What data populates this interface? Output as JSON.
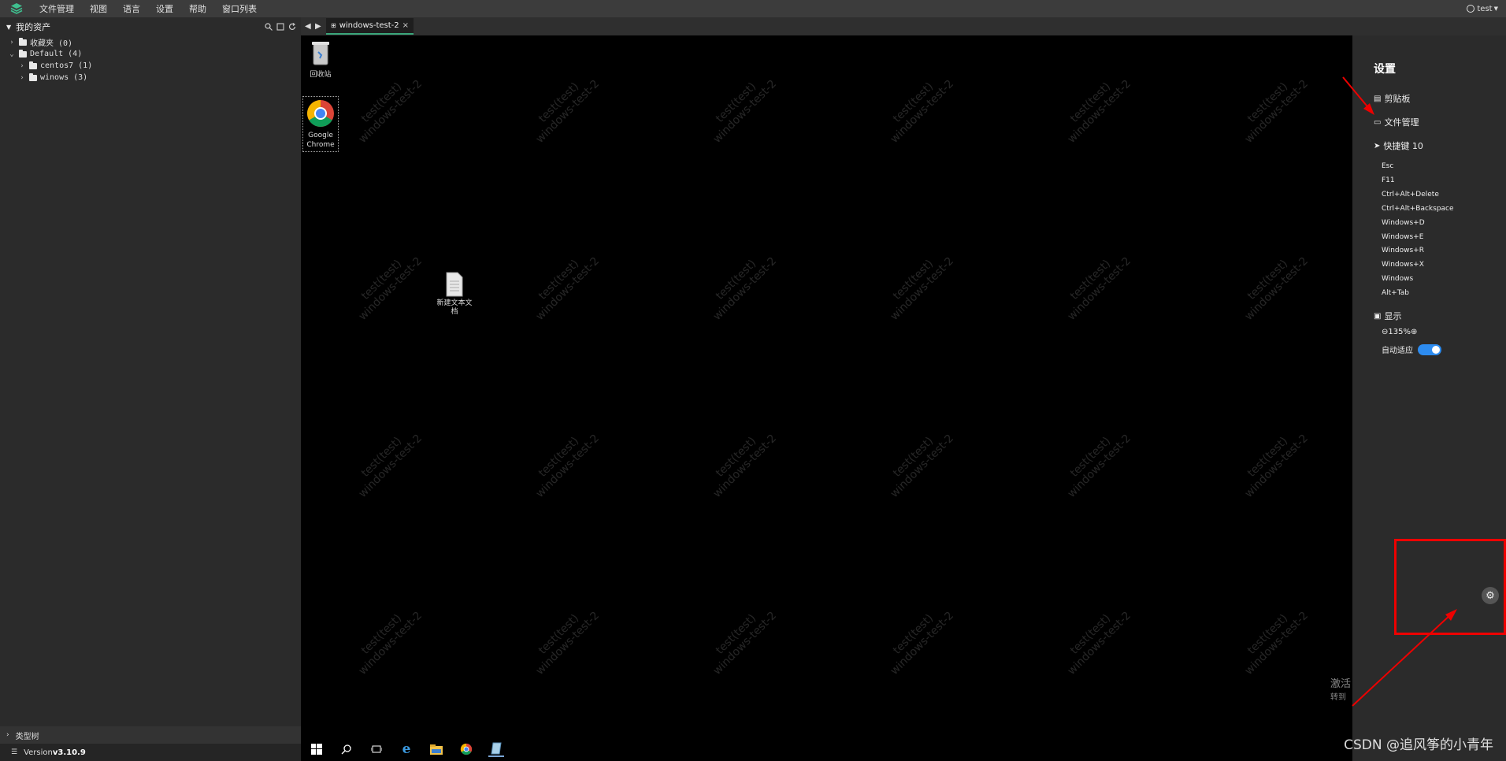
{
  "menubar": {
    "items": [
      "文件管理",
      "视图",
      "语言",
      "设置",
      "帮助",
      "窗口列表"
    ],
    "user": "test"
  },
  "left_panel": {
    "title": "我的资产",
    "tree": [
      {
        "label": "收藏夹 (0)",
        "level": 0,
        "expanded": false
      },
      {
        "label": "Default (4)",
        "level": 0,
        "expanded": true
      },
      {
        "label": "centos7 (1)",
        "level": 1,
        "expanded": false
      },
      {
        "label": "winows (3)",
        "level": 1,
        "expanded": false
      }
    ],
    "type_tree": "类型树",
    "version_label": "Version ",
    "version_value": "v3.10.9"
  },
  "tabbar": {
    "tab_label": "windows-test-2"
  },
  "desktop": {
    "watermark_line1": "test(test)",
    "watermark_line2": "windows-test-2",
    "icons": {
      "recycle_bin": "回收站",
      "chrome": "Google Chrome",
      "text_doc": "新建文本文档"
    },
    "activate_line1": "激活",
    "activate_line2": "转到"
  },
  "settings": {
    "title": "设置",
    "clipboard": "剪贴板",
    "file_manager": "文件管理",
    "shortcuts": "快捷键 10",
    "keys": [
      "Esc",
      "F11",
      "Ctrl+Alt+Delete",
      "Ctrl+Alt+Backspace",
      "Windows+D",
      "Windows+E",
      "Windows+R",
      "Windows+X",
      "Windows",
      "Alt+Tab"
    ],
    "display": "显示",
    "zoom": "135%",
    "auto_fit": "自动适应",
    "auto_fit_on": true
  },
  "overlay": {
    "csdn": "CSDN @追风筝的小青年",
    "accent": "#e00000"
  }
}
